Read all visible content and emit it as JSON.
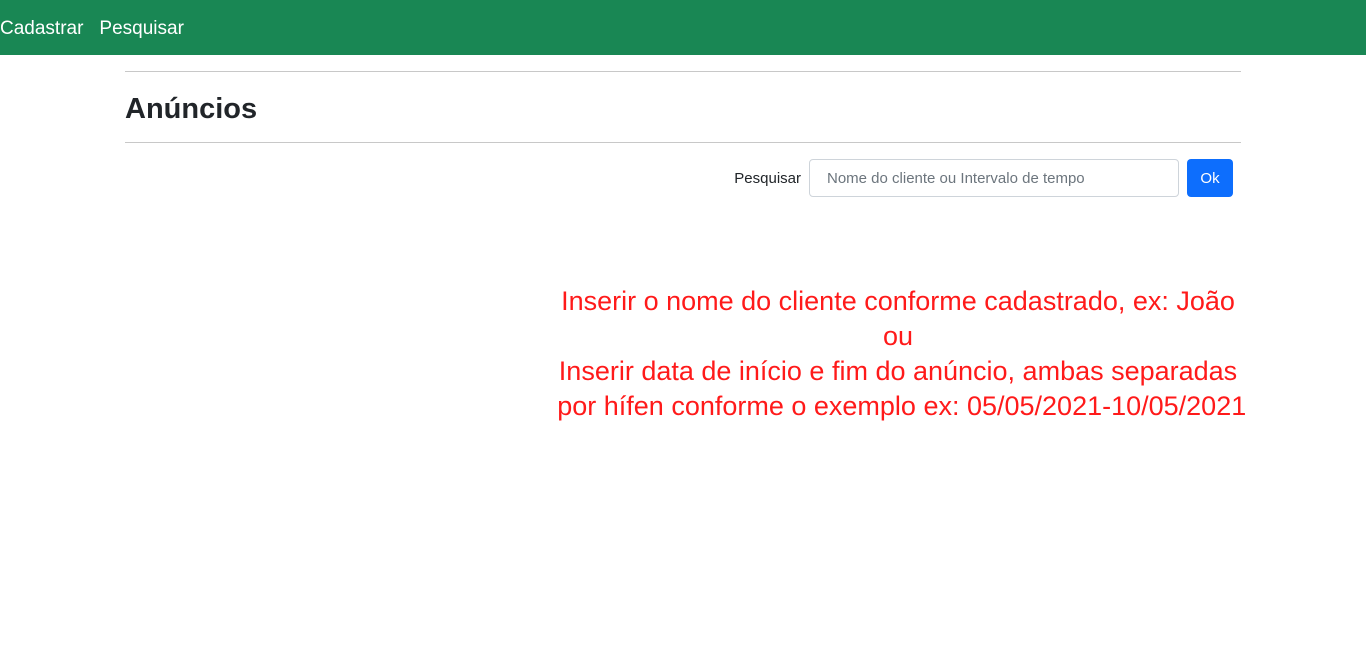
{
  "nav": {
    "items": [
      {
        "label": "Cadastrar"
      },
      {
        "label": "Pesquisar"
      }
    ],
    "color": "#198754"
  },
  "page": {
    "title": "Anúncios"
  },
  "search": {
    "label": "Pesquisar",
    "placeholder": "Nome do cliente ou Intervalo de tempo",
    "value": "",
    "button_label": "Ok"
  },
  "hint": {
    "lines": [
      "Inserir o nome do cliente conforme cadastrado, ex: João",
      "ou",
      "Inserir data de início e fim do anúncio, ambas separadas",
      " por hífen conforme o exemplo ex: 05/05/2021-10/05/2021"
    ],
    "color": "#ff1a1a"
  }
}
